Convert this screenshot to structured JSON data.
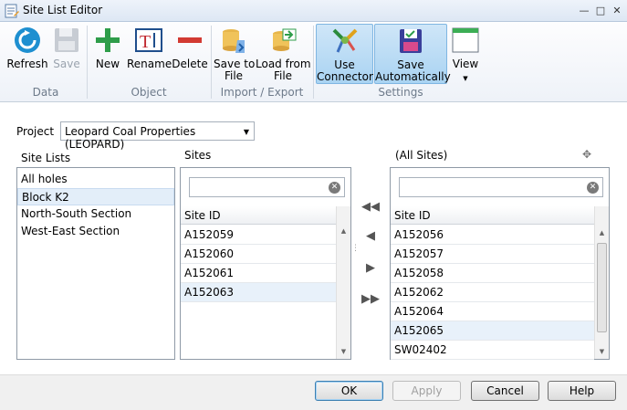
{
  "window": {
    "title": "Site List Editor"
  },
  "ribbon": {
    "buttons": {
      "refresh": "Refresh",
      "save": "Save",
      "new": "New",
      "rename": "Rename",
      "delete": "Delete",
      "save_to_file_1": "Save to",
      "save_to_file_2": "File",
      "load_from_file_1": "Load from",
      "load_from_file_2": "File",
      "use_connector_1": "Use",
      "use_connector_2": "Connector",
      "save_auto_1": "Save",
      "save_auto_2": "Automatically",
      "view": "View"
    },
    "groups": {
      "data": "Data",
      "object": "Object",
      "import_export": "Import / Export",
      "settings": "Settings"
    }
  },
  "project": {
    "label": "Project",
    "value": "Leopard Coal Properties (LEOPARD)"
  },
  "site_lists": {
    "label": "Site Lists",
    "items": [
      {
        "label": "All holes"
      },
      {
        "label": "Block K2"
      },
      {
        "label": "North-South Section"
      },
      {
        "label": "West-East Section"
      }
    ],
    "selected": "Block K2"
  },
  "sites": {
    "label": "Sites",
    "search_value": "",
    "column": "Site ID",
    "rows": [
      "A152059",
      "A152060",
      "A152061",
      "A152063"
    ],
    "selected": "A152063"
  },
  "all_sites": {
    "label": "(All Sites)",
    "search_value": "",
    "column": "Site ID",
    "rows": [
      "A152056",
      "A152057",
      "A152058",
      "A152062",
      "A152064",
      "A152065",
      "SW02402"
    ],
    "selected": "A152065"
  },
  "footer": {
    "ok": "OK",
    "apply": "Apply",
    "cancel": "Cancel",
    "help": "Help"
  },
  "colors": {
    "accent": "#1f9bd7",
    "ribbon_active": "#a9d3f2",
    "selection": "#e3eef9"
  }
}
